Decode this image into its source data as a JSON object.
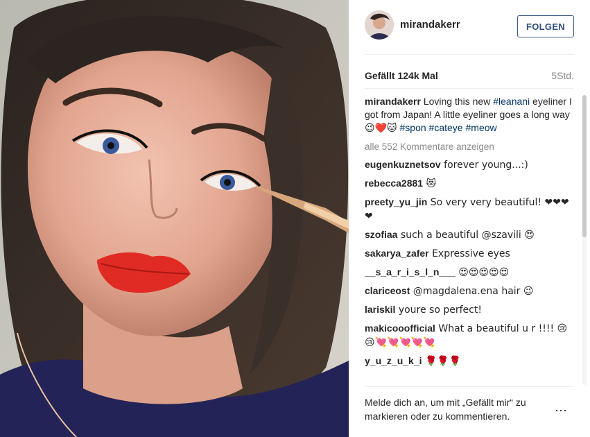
{
  "post": {
    "username": "mirandakerr",
    "follow_label": "FOLGEN",
    "likes": "Gefällt 124k Mal",
    "time": "5Std."
  },
  "caption": {
    "username": "mirandakerr",
    "text_1": " Loving this new ",
    "tag_1": "#leanani",
    "text_2": " eyeliner I got from Japan! A little eyeliner goes a long way ",
    "emoji": "😉❤️🐱",
    "tag_2": " #spon",
    "tag_3": " #cateye",
    "tag_4": " #meow"
  },
  "view_all": "alle 552 Kommentare anzeigen",
  "comments": [
    {
      "user": "eugenkuznetsov",
      "text": " forever young...:)"
    },
    {
      "user": "rebecca2881",
      "text": " 😻"
    },
    {
      "user": "preety_yu_jin",
      "text": " So very very beautiful! ❤❤❤❤"
    },
    {
      "user": "szofiaa",
      "text": " such a beautiful @szavili 😍"
    },
    {
      "user": "sakarya_zafer",
      "text": " Expressive eyes"
    },
    {
      "user": "__s_a_r_i_s_l_n___",
      "text": " 😍😍😍😍😍"
    },
    {
      "user": "clariceost",
      "text": " @magdalena.ena hair 😉"
    },
    {
      "user": "lariskil",
      "text": " youre so perfect!"
    },
    {
      "user": "makicooofficial",
      "text": " What a beautiful u r !!!! 😢😢💘💘💘💘💘"
    },
    {
      "user": "y_u_z_u_k_i",
      "text": " 🌹🌹🌹"
    }
  ],
  "footer": {
    "login_text": "Melde dich an, um mit „Gefällt mir“ zu markieren oder zu kommentieren.",
    "more_icon": "⋯"
  }
}
